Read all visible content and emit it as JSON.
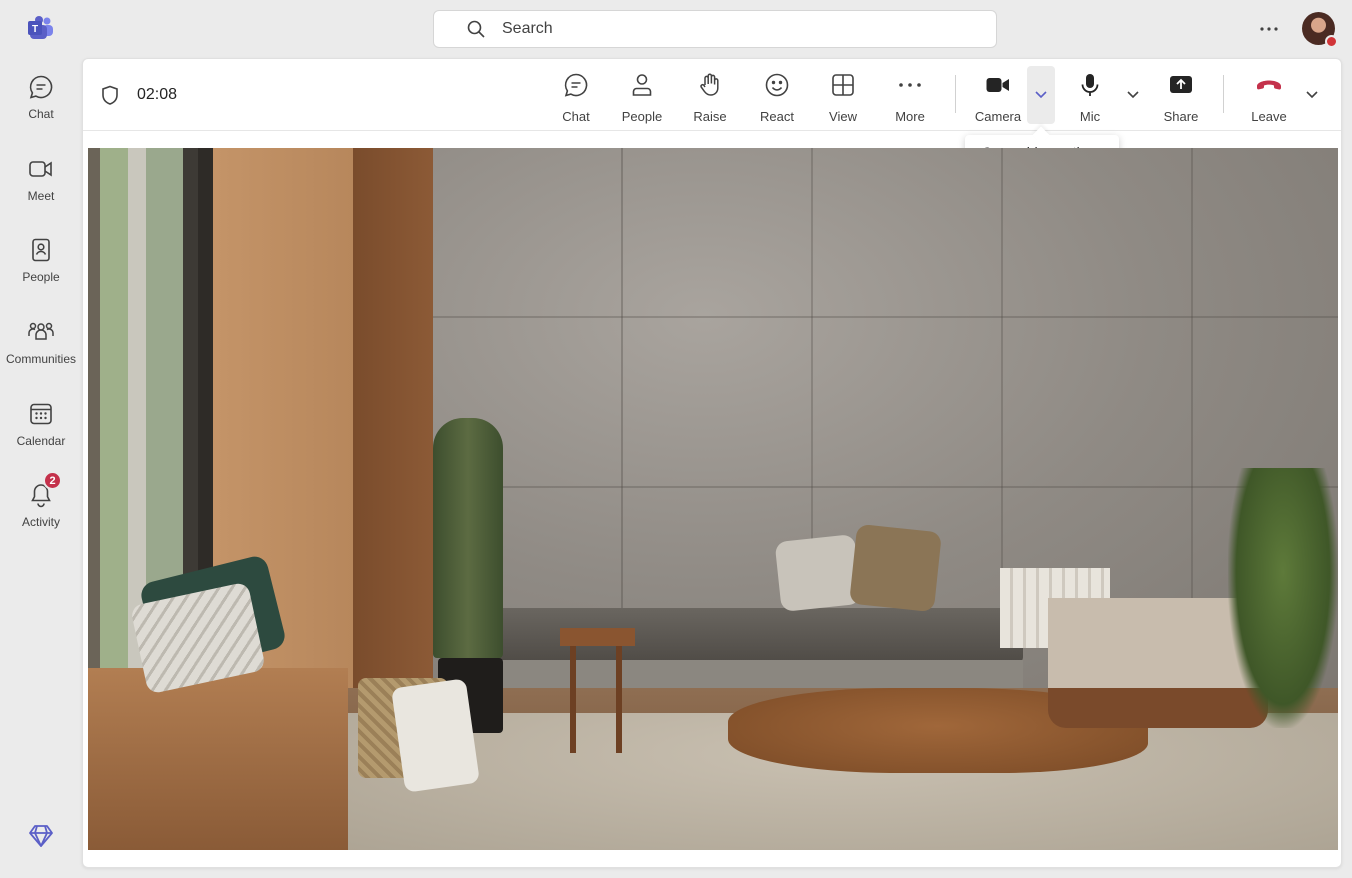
{
  "rail": {
    "items": [
      {
        "label": "Chat",
        "icon": "chat-icon"
      },
      {
        "label": "Meet",
        "icon": "video-camera-icon"
      },
      {
        "label": "People",
        "icon": "contact-book-icon"
      },
      {
        "label": "Communities",
        "icon": "communities-icon"
      },
      {
        "label": "Calendar",
        "icon": "calendar-icon"
      },
      {
        "label": "Activity",
        "icon": "bell-icon",
        "badge": "2"
      }
    ]
  },
  "topbar": {
    "search_placeholder": "Search"
  },
  "meeting": {
    "timer": "02:08",
    "toolbar": {
      "chat_label": "Chat",
      "people_label": "People",
      "raise_label": "Raise",
      "react_label": "React",
      "view_label": "View",
      "more_label": "More",
      "camera_label": "Camera",
      "mic_label": "Mic",
      "share_label": "Share",
      "leave_label": "Leave"
    },
    "tooltip": "Open video options"
  },
  "colors": {
    "teams_purple": "#5b5fc7",
    "leave_red": "#c4314b",
    "badge_red": "#c4314b",
    "presence_busy": "#d13438"
  }
}
